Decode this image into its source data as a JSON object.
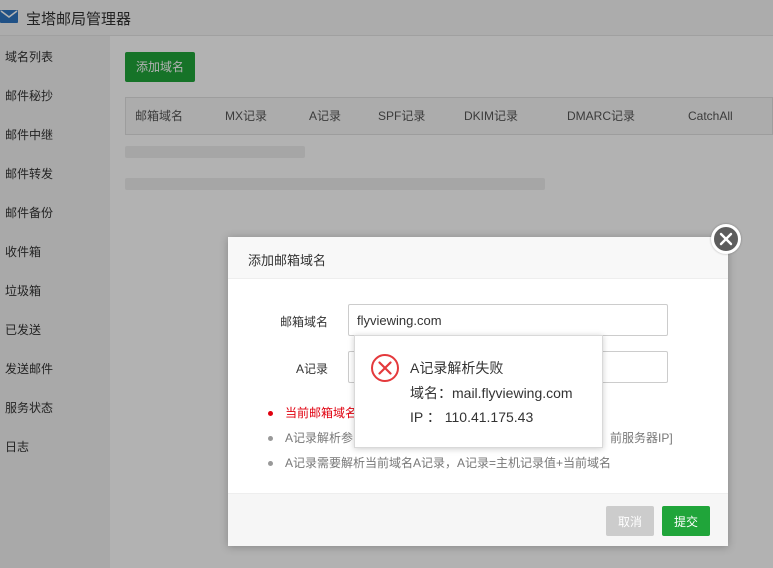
{
  "app": {
    "title": "宝塔邮局管理器",
    "icon": "mail-icon"
  },
  "sidebar": {
    "items": [
      {
        "label": "域名列表"
      },
      {
        "label": "邮件秘抄"
      },
      {
        "label": "邮件中继"
      },
      {
        "label": "邮件转发"
      },
      {
        "label": "邮件备份"
      },
      {
        "label": "收件箱"
      },
      {
        "label": "垃圾箱"
      },
      {
        "label": "已发送"
      },
      {
        "label": "发送邮件"
      },
      {
        "label": "服务状态"
      },
      {
        "label": "日志"
      }
    ]
  },
  "main": {
    "add_button": "添加域名",
    "table_headers": [
      "邮箱域名",
      "MX记录",
      "A记录",
      "SPF记录",
      "DKIM记录",
      "DMARC记录",
      "CatchAll"
    ]
  },
  "dialog": {
    "title": "添加邮箱域名",
    "domain_label": "邮箱域名",
    "domain_value": "flyviewing.com",
    "a_record_label": "A记录",
    "a_record_value": "",
    "tips": [
      "当前邮箱域名",
      "A记录解析参",
      "A记录需要解析当前域名A记录，A记录=主机记录值+当前域名"
    ],
    "tip_tail": "前服务器IP]",
    "cancel_label": "取消",
    "submit_label": "提交"
  },
  "popup": {
    "icon": "error-circle-icon",
    "title": "A记录解析失败",
    "domain_line": "域名：mail.flyviewing.com",
    "ip_line": "IP ： 110.41.175.43"
  },
  "colors": {
    "accent_green": "#20a53a",
    "error_red": "#e0000f",
    "cancel_gray": "#cccccc",
    "icon_red": "#e4393c"
  }
}
